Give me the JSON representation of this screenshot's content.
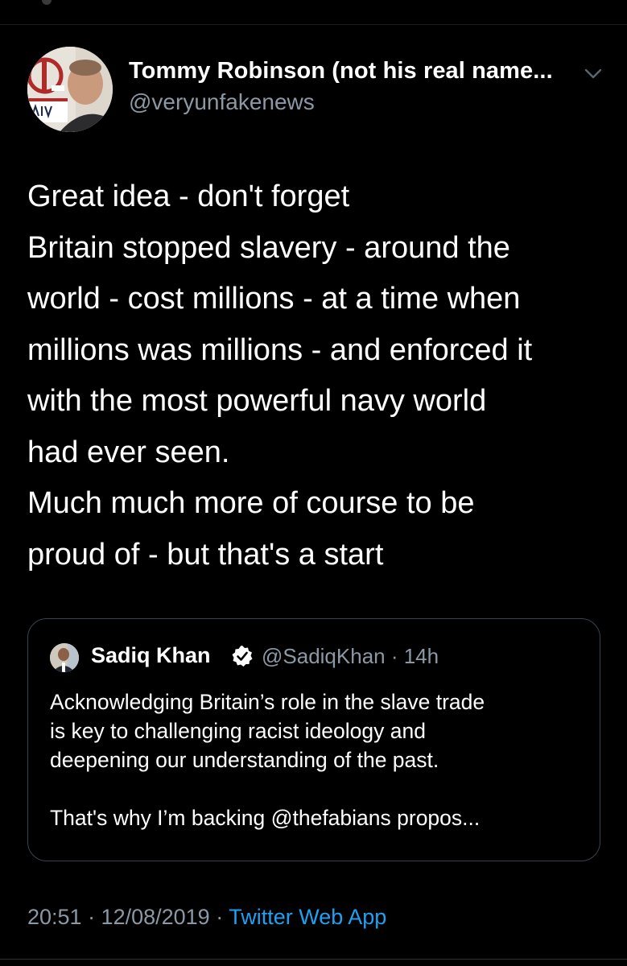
{
  "colors": {
    "background": "#000000",
    "text": "#ffffff",
    "muted": "#8b98a5",
    "link": "#1da1f2",
    "border": "#38444d"
  },
  "tweet": {
    "author_name": "Tommy Robinson (not his real name...",
    "author_handle": "@veryunfakenews",
    "avatar_icon": "profile-photo-icon",
    "menu_icon": "chevron-down-icon",
    "lines": [
      "Great idea - don't forget",
      "Britain stopped slavery - around the",
      "world - cost millions - at a time when",
      "millions was millions - and enforced it",
      "with the most powerful navy world",
      "had ever seen.",
      "Much much more of course to be",
      "proud of - but that's a start"
    ]
  },
  "quoted_tweet": {
    "author_name": "Sadiq Khan",
    "verified_icon": "verified-badge-icon",
    "handle_time": "@SadiqKhan · 14h",
    "lines": [
      "Acknowledging Britain’s role in the slave trade",
      "is key to challenging racist ideology and",
      "deepening our understanding of the past."
    ],
    "truncated_line": "That's why I’m backing @thefabians propos..."
  },
  "footer": {
    "timestamp": "20:51 · 12/08/2019 · ",
    "source": "Twitter Web App"
  }
}
